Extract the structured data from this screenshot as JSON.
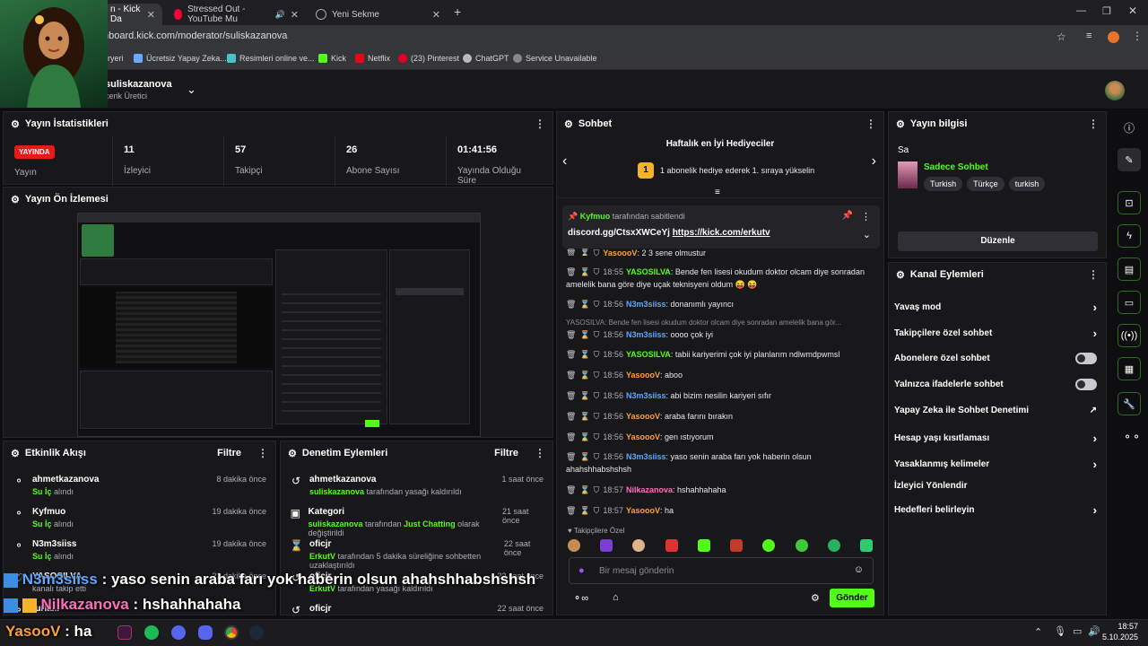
{
  "tabs": [
    {
      "label": "n - Kick Da",
      "active": true
    },
    {
      "label": "Stressed Out - YouTube Mu",
      "active": false
    },
    {
      "label": "Yeni Sekme",
      "active": false
    }
  ],
  "url": "hboard.kick.com/moderator/suliskazanova",
  "bookmarks": [
    "aryeri",
    "Ücretsiz Yapay Zeka...",
    "Resimleri online ve...",
    "Kick",
    "Netflix",
    "(23) Pinterest",
    "ChatGPT",
    "Service Unavailable"
  ],
  "header": {
    "channel": "suliskazanova",
    "role": "çerik Üretici"
  },
  "stats": {
    "title": "Yayın İstatistikleri",
    "live_badge": "YAYINDA",
    "live_label": "Yayın",
    "items": [
      {
        "value": "11",
        "label": "İzleyici"
      },
      {
        "value": "57",
        "label": "Takipçi"
      },
      {
        "value": "26",
        "label": "Abone Sayısı"
      },
      {
        "value": "01:41:56",
        "label": "Yayında Olduğu Süre"
      }
    ]
  },
  "preview": {
    "title": "Yayın Ön İzlemesi"
  },
  "activity": {
    "title": "Etkinlik Akışı",
    "filter": "Filtre",
    "items": [
      {
        "name": "ahmetkazanova",
        "action": "Su İç",
        "suffix": "alındı",
        "time": "8 dakika önce"
      },
      {
        "name": "Kyfmuo",
        "action": "Su İç",
        "suffix": "alındı",
        "time": "19 dakika önce"
      },
      {
        "name": "N3m3siiss",
        "action": "Su İç",
        "suffix": "alındı",
        "time": "19 dakika önce"
      },
      {
        "name": "YASOSILVA",
        "action": "",
        "suffix": "kanalı takip etti",
        "time": "21 dakika önce"
      },
      {
        "name": "turla...",
        "action": "",
        "suffix": "",
        "time": ""
      }
    ]
  },
  "moderation": {
    "title": "Denetim Eylemleri",
    "filter": "Filtre",
    "items": [
      {
        "name": "ahmetkazanova",
        "actor": "suliskazanova",
        "text": "tarafından yasağı kaldırıldı",
        "extra": "",
        "extra2": "",
        "time": "1 saat önce"
      },
      {
        "name": "Kategori",
        "actor": "suliskazanova",
        "text": "tarafından",
        "extra": "Just Chatting",
        "extra2": "olarak değiştirildi",
        "time": "21 saat önce"
      },
      {
        "name": "oficjr",
        "actor": "ErkutV",
        "text": "tarafından 5 dakika süreliğine sohbetten uzaklaştırıldı",
        "extra": "",
        "extra2": "",
        "time": "22 saat önce"
      },
      {
        "name": "oficjr",
        "actor": "ErkutV",
        "text": "tarafından yasağı kaldırıldı",
        "extra": "",
        "extra2": "",
        "time": "22 saat önce"
      },
      {
        "name": "oficjr",
        "actor": "",
        "text": "",
        "extra": "",
        "extra2": "",
        "time": "22 saat önce"
      }
    ]
  },
  "chat": {
    "title": "Sohbet",
    "gifters_title": "Haftalık en İyi Hediyeciler",
    "gifters_rank": "1",
    "gifters_text": "1 abonelik hediye ederek 1. sıraya yükselin",
    "pinned_by": "Kyfmuo",
    "pinned_suffix": "tarafından sabitlendi",
    "pinned_text": "discord.gg/CtsxXWCeYj",
    "pinned_link": "https://kick.com/erkutv",
    "messages": [
      {
        "time": "",
        "user": "YasoooV",
        "text": "2 3 sene olmustur",
        "color": "orange"
      },
      {
        "time": "18:55",
        "user": "YASOSILVA",
        "text": "Bende fen lisesi okudum doktor olcam diye sonradan amelelik bana göre diye uçak teknisyeni oldum 😝 😝",
        "color": "green"
      },
      {
        "time": "18:56",
        "user": "N3m3siiss",
        "text": "donanımlı yayıncı",
        "color": "blue"
      },
      {
        "time": "18:56",
        "user": "N3m3siiss",
        "text": "oooo çok iyi",
        "color": "blue"
      },
      {
        "time": "18:56",
        "user": "YASOSILVA",
        "text": "tabii kariyerimi çok iyi planlarım ndlwmdpwmsl",
        "color": "green"
      },
      {
        "time": "18:56",
        "user": "YasoooV",
        "text": "aboo",
        "color": "orange"
      },
      {
        "time": "18:56",
        "user": "N3m3siiss",
        "text": "abi bizim nesilin kariyeri sıfır",
        "color": "blue"
      },
      {
        "time": "18:56",
        "user": "YasoooV",
        "text": "araba farını bırakın",
        "color": "orange"
      },
      {
        "time": "18:56",
        "user": "YasoooV",
        "text": "gen ıstıyorum",
        "color": "orange"
      },
      {
        "time": "18:56",
        "user": "N3m3siiss",
        "text": "yaso senin araba farı yok haberin olsun ahahshhabshshsh",
        "color": "blue"
      },
      {
        "time": "18:57",
        "user": "Nilkazanova",
        "text": "hshahhahaha",
        "color": "pink"
      },
      {
        "time": "18:57",
        "user": "YasoooV",
        "text": "ha",
        "color": "orange"
      }
    ],
    "reply_preview": "YASOSILVA: Bende fen lisesi okudum doktor olcam diye sonradan amelelik bana gör...",
    "followers_only": "Takipçilere Özel",
    "input_placeholder": "Bir mesaj gönderin",
    "send_label": "Gönder"
  },
  "stream_info": {
    "title": "Yayın bilgisi",
    "stream_title": "Sa",
    "category": "Sadece Sohbet",
    "tags": [
      "Turkish",
      "Türkçe",
      "turkish"
    ],
    "edit_label": "Düzenle"
  },
  "channel_actions": {
    "title": "Kanal Eylemleri",
    "items": [
      {
        "label": "Yavaş mod",
        "control": "chevron"
      },
      {
        "label": "Takipçilere özel sohbet",
        "control": "chevron"
      },
      {
        "label": "Abonelere özel sohbet",
        "control": "toggle"
      },
      {
        "label": "Yalnızca ifadelerle sohbet",
        "control": "toggle"
      },
      {
        "label": "Yapay Zeka ile Sohbet Denetimi",
        "control": "external"
      },
      {
        "label": "Hesap yaşı kısıtlaması",
        "control": "chevron"
      },
      {
        "label": "Yasaklanmış kelimeler",
        "control": "chevron"
      },
      {
        "label": "İzleyici Yönlendir",
        "control": "none"
      },
      {
        "label": "Hedefleri belirleyin",
        "control": "chevron"
      }
    ]
  },
  "overlay": {
    "line1_user": "N3m3siiss",
    "line1_text": "yaso senin araba farı yok haberin olsun ahahshhabshshsh",
    "line2_user": "Nilkazanova",
    "line2_text": "hshahhahaha",
    "line3_user": "YasooV",
    "line3_text": "ha"
  },
  "taskbar": {
    "time": "18:57",
    "date": "5.10.2025"
  },
  "colors": {
    "accent": "#53fc18",
    "live": "#e91916",
    "panel": "#18181b"
  }
}
